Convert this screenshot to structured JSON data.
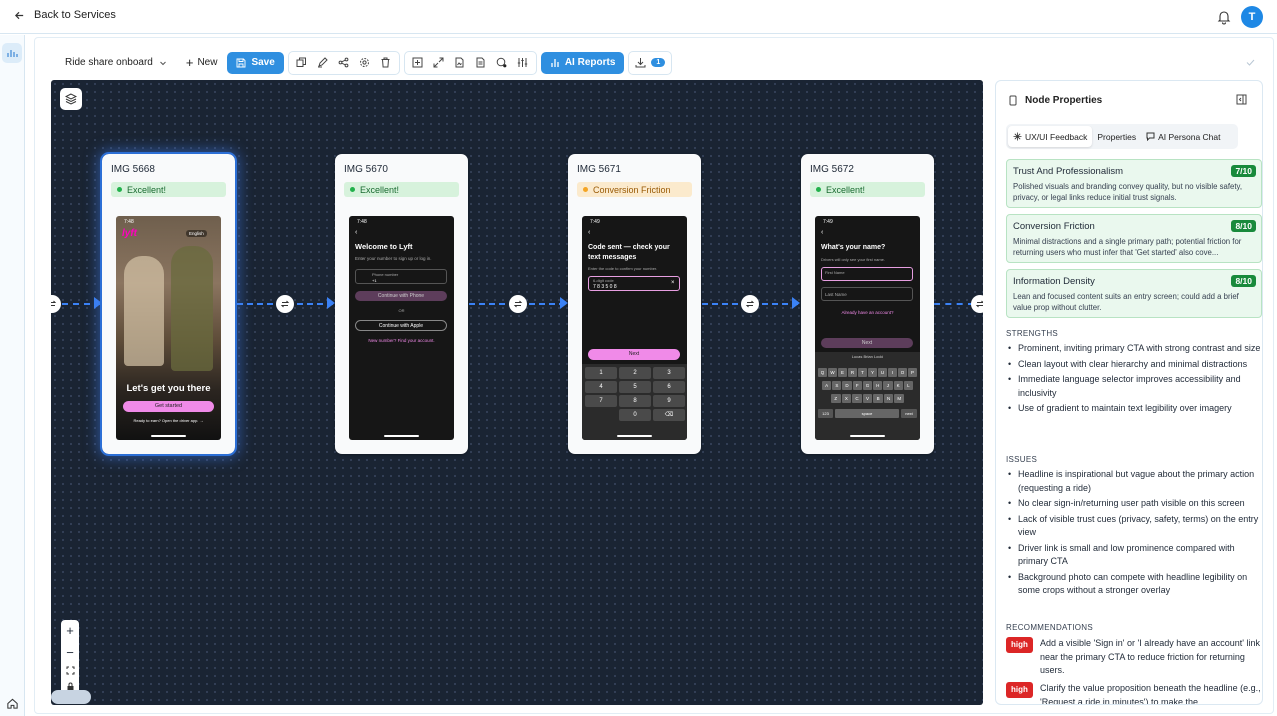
{
  "topbar": {
    "back_label": "Back to Services",
    "avatar_initial": "T"
  },
  "toolbar": {
    "project_name": "Ride share onboard",
    "new_label": "New",
    "save_label": "Save",
    "ai_reports_label": "AI Reports",
    "download_count": "1"
  },
  "colors": {
    "accent": "#2f8fe0",
    "canvas": "#1a2433",
    "edge": "#3b82f6",
    "good": "#22b14c",
    "warn": "#f4a524",
    "high": "#dc2626"
  },
  "nodes": [
    {
      "title": "IMG 5668",
      "status": "Excellent!",
      "status_type": "good"
    },
    {
      "title": "IMG 5670",
      "status": "Excellent!",
      "status_type": "good"
    },
    {
      "title": "IMG 5671",
      "status": "Conversion Friction",
      "status_type": "warn"
    },
    {
      "title": "IMG 5672",
      "status": "Excellent!",
      "status_type": "good"
    }
  ],
  "screens": {
    "s1": {
      "time": "7:48",
      "lang": "English",
      "logo": "lyft",
      "headline": "Let's get you there",
      "cta": "Get started",
      "footer": "Ready to earn? Open the driver app. →"
    },
    "s2": {
      "time": "7:48",
      "headline": "Welcome to Lyft",
      "sub": "Enter your number to sign up or log in.",
      "phone_label": "Phone number",
      "prefix": "+1",
      "cta": "Continue with Phone",
      "or": "OR",
      "apple": "Continue with Apple",
      "link": "New number? Find your account."
    },
    "s3": {
      "time": "7:49",
      "headline": "Code sent — check your text messages",
      "sub": "Enter the code to confirm your number.",
      "code_label": "6-digit code",
      "code": "7 8 3 5 0 8",
      "cta": "Next",
      "keys": [
        "1",
        "2",
        "3",
        "4",
        "5",
        "6",
        "7",
        "8",
        "9",
        "",
        "0",
        "⌫"
      ]
    },
    "s4": {
      "time": "7:49",
      "headline": "What's your name?",
      "sub": "Drivers will only see your first name.",
      "first": "First Name",
      "last": "Last Name",
      "link": "Already have an account?",
      "cta": "Next",
      "suggest": "Lucas   Brian   Locki",
      "row1": [
        "Q",
        "W",
        "E",
        "R",
        "T",
        "Y",
        "U",
        "I",
        "O",
        "P"
      ],
      "row2": [
        "A",
        "S",
        "D",
        "F",
        "G",
        "H",
        "J",
        "K",
        "L"
      ],
      "row3": [
        "Z",
        "X",
        "C",
        "V",
        "B",
        "N",
        "M"
      ],
      "space": "space",
      "next": "next",
      "num": "123"
    }
  },
  "panel": {
    "title": "Node Properties",
    "tabs": [
      "UX/UI Feedback",
      "Properties",
      "AI Persona Chat"
    ],
    "scores": [
      {
        "title": "Trust And Professionalism",
        "value": "7/10",
        "desc": "Polished visuals and branding convey quality, but no visible safety, privacy, or legal links reduce initial trust signals."
      },
      {
        "title": "Conversion Friction",
        "value": "8/10",
        "desc": "Minimal distractions and a single primary path; potential friction for returning users who must infer that 'Get started' also cove..."
      },
      {
        "title": "Information Density",
        "value": "8/10",
        "desc": "Lean and focused content suits an entry screen; could add a brief value prop without clutter."
      }
    ],
    "strengths_label": "STRENGTHS",
    "strengths": [
      "Prominent, inviting primary CTA with strong contrast and size",
      "Clean layout with clear hierarchy and minimal distractions",
      "Immediate language selector improves accessibility and inclusivity",
      "Use of gradient to maintain text legibility over imagery"
    ],
    "issues_label": "ISSUES",
    "issues": [
      "Headline is inspirational but vague about the primary action (requesting a ride)",
      "No clear sign-in/returning user path visible on this screen",
      "Lack of visible trust cues (privacy, safety, terms) on the entry view",
      "Driver link is small and low prominence compared with primary CTA",
      "Background photo can compete with headline legibility on some crops without a stronger overlay"
    ],
    "recs_label": "RECOMMENDATIONS",
    "recs": [
      {
        "level": "high",
        "text": "Add a visible 'Sign in' or 'I already have an account' link near the primary CTA to reduce friction for returning users."
      },
      {
        "level": "high",
        "text": "Clarify the value proposition beneath the headline (e.g., 'Request a ride in minutes') to make the"
      }
    ]
  }
}
